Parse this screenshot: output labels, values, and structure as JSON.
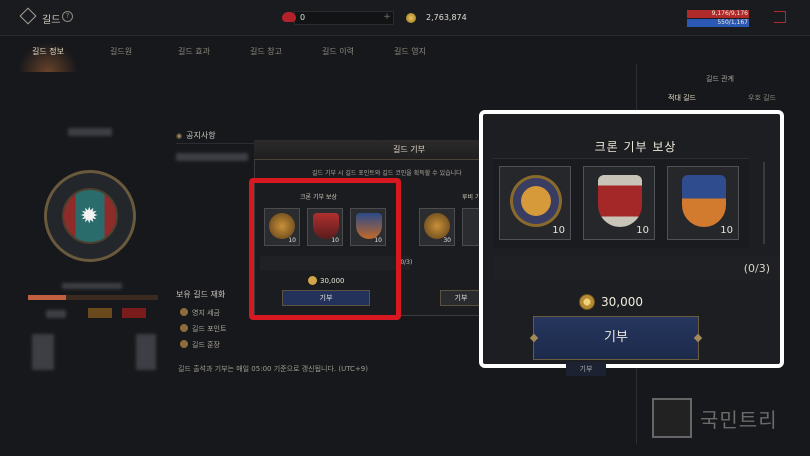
{
  "header": {
    "title": "길드",
    "help_icon": "?",
    "gem_count": "0",
    "gem_plus": "+",
    "coins": "2,763,874",
    "hp": "9,176/9,176",
    "mp": "550/1,167"
  },
  "tabs": [
    "길드 정보",
    "길드원",
    "길드 효과",
    "길드 창고",
    "길드 이력",
    "길드 영지"
  ],
  "notice": {
    "heading": "공지사항"
  },
  "assets": {
    "heading": "보유 길드 재화",
    "rows": [
      "영지 세금",
      "길드 포인트",
      "길드 훈장"
    ]
  },
  "footnote": "길드 출석과 기부는 매일 05:00 기준으로 갱신됩니다. (UTC+9)",
  "modal": {
    "title": "길드 기부",
    "description": "길드 기부 시 길드 포인트와 길드 코인을 획득할 수 있습니다",
    "sections": [
      {
        "title": "크론 기부 보상",
        "items": [
          {
            "count": "10"
          },
          {
            "count": "10"
          },
          {
            "count": "10"
          }
        ],
        "progress": "(0/3)",
        "cost": "30,000",
        "button": "기부"
      },
      {
        "title": "루비 기부 보상",
        "items": [
          {
            "count": "30"
          },
          {
            "count": ""
          }
        ],
        "button": "기부"
      }
    ]
  },
  "zoom": {
    "title": "크론 기부 보상",
    "items": [
      {
        "count": "10"
      },
      {
        "count": "10"
      },
      {
        "count": "10"
      }
    ],
    "progress": "(0/3)",
    "cost": "30,000",
    "button": "기부"
  },
  "relations": {
    "heading": "길드 관계",
    "tabs": [
      "적대 길드",
      "우호 길드"
    ]
  },
  "watermark": "국민트리",
  "colors": {
    "highlight": "#d81820",
    "hp": "#b02a2a",
    "mp": "#2b58b3",
    "button": "#22325a"
  }
}
